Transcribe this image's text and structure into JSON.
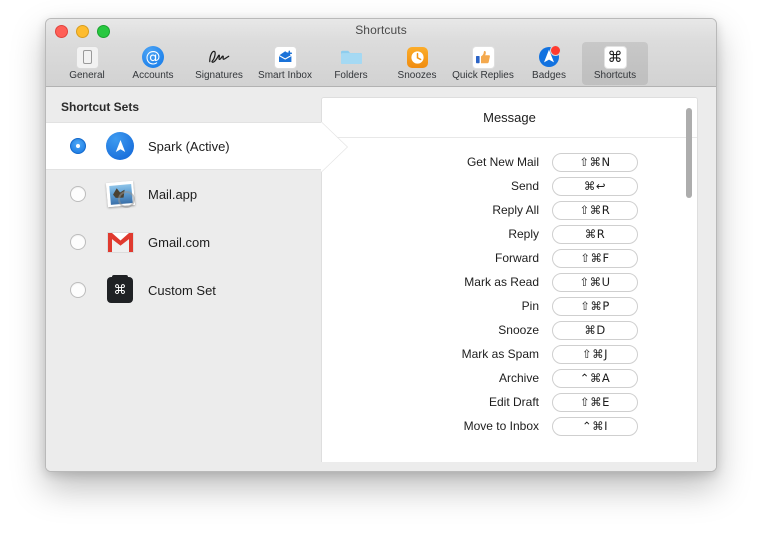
{
  "window": {
    "title": "Shortcuts",
    "traffic_lights": [
      "close-button",
      "minimize-button",
      "maximize-button"
    ]
  },
  "toolbar": {
    "items": [
      {
        "label": "General",
        "icon": "general-icon",
        "selected": false
      },
      {
        "label": "Accounts",
        "icon": "accounts-icon",
        "selected": false
      },
      {
        "label": "Signatures",
        "icon": "signatures-icon",
        "selected": false
      },
      {
        "label": "Smart Inbox",
        "icon": "smart-inbox-icon",
        "selected": false
      },
      {
        "label": "Folders",
        "icon": "folders-icon",
        "selected": false
      },
      {
        "label": "Snoozes",
        "icon": "snoozes-icon",
        "selected": false
      },
      {
        "label": "Quick Replies",
        "icon": "quick-replies-icon",
        "selected": false
      },
      {
        "label": "Badges",
        "icon": "badges-icon",
        "selected": false
      },
      {
        "label": "Shortcuts",
        "icon": "shortcuts-icon",
        "selected": true
      }
    ]
  },
  "sidebar": {
    "title": "Shortcut Sets",
    "items": [
      {
        "label": "Spark (Active)",
        "icon": "spark-icon",
        "selected": true
      },
      {
        "label": "Mail.app",
        "icon": "mail-app-icon",
        "selected": false
      },
      {
        "label": "Gmail.com",
        "icon": "gmail-icon",
        "selected": false
      },
      {
        "label": "Custom Set",
        "icon": "custom-set-icon",
        "selected": false
      }
    ]
  },
  "content": {
    "section_title": "Message",
    "shortcuts": [
      {
        "action": "Get New Mail",
        "keys": "⇧⌘N"
      },
      {
        "action": "Send",
        "keys": "⌘↩"
      },
      {
        "action": "Reply All",
        "keys": "⇧⌘R"
      },
      {
        "action": "Reply",
        "keys": "⌘R"
      },
      {
        "action": "Forward",
        "keys": "⇧⌘F"
      },
      {
        "action": "Mark as Read",
        "keys": "⇧⌘U"
      },
      {
        "action": "Pin",
        "keys": "⇧⌘P"
      },
      {
        "action": "Snooze",
        "keys": "⌘D"
      },
      {
        "action": "Mark as Spam",
        "keys": "⇧⌘J"
      },
      {
        "action": "Archive",
        "keys": "⌃⌘A"
      },
      {
        "action": "Edit Draft",
        "keys": "⇧⌘E"
      },
      {
        "action": "Move to Inbox",
        "keys": "⌃⌘I"
      }
    ]
  },
  "colors": {
    "accent_blue": "#1575e0",
    "window_chrome": "#ececec",
    "toolbar": "#d6d6d6",
    "panel_white": "#ffffff",
    "badge_red": "#ff3b30",
    "snooze_orange": "#f5a01e",
    "folder_blue": "#7fc8ee",
    "gmail_red": "#e03a2f"
  }
}
